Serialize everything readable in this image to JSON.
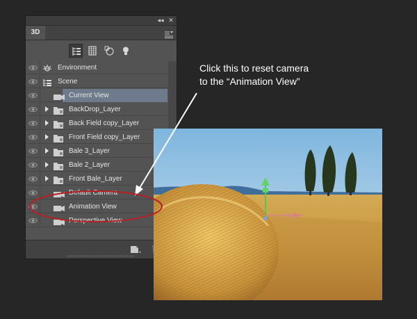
{
  "panel": {
    "tab_label": "3D",
    "collapse_glyph": "◂◂",
    "close_glyph": "✕",
    "tools": [
      {
        "name": "scene-filter-icon",
        "active": true
      },
      {
        "name": "mesh-filter-icon",
        "active": false
      },
      {
        "name": "materials-filter-icon",
        "active": false
      },
      {
        "name": "lights-filter-icon",
        "active": false
      }
    ],
    "rows": [
      {
        "label": "Environment",
        "indent": 0,
        "icon": "environment-icon",
        "arrow": false,
        "eye": true,
        "selected": false
      },
      {
        "label": "Scene",
        "indent": 0,
        "icon": "scene-icon",
        "arrow": false,
        "eye": true,
        "selected": false
      },
      {
        "label": "Current View",
        "indent": 2,
        "icon": "camera-icon",
        "arrow": false,
        "eye": true,
        "selected": true
      },
      {
        "label": "BackDrop_Layer",
        "indent": 1,
        "icon": "mesh-folder-icon",
        "arrow": true,
        "eye": true,
        "selected": false
      },
      {
        "label": "Back Field copy_Layer",
        "indent": 1,
        "icon": "mesh-folder-icon",
        "arrow": true,
        "eye": true,
        "selected": false
      },
      {
        "label": "Front Field copy_Layer",
        "indent": 1,
        "icon": "mesh-folder-icon",
        "arrow": true,
        "eye": true,
        "selected": false
      },
      {
        "label": "Bale 3_Layer",
        "indent": 1,
        "icon": "mesh-folder-icon",
        "arrow": true,
        "eye": true,
        "selected": false
      },
      {
        "label": "Bale 2_Layer",
        "indent": 1,
        "icon": "mesh-folder-icon",
        "arrow": true,
        "eye": true,
        "selected": false
      },
      {
        "label": "Front Bale_Layer",
        "indent": 1,
        "icon": "mesh-folder-icon",
        "arrow": true,
        "eye": true,
        "selected": false
      },
      {
        "label": "Default Camera",
        "indent": 2,
        "icon": "camera-icon",
        "arrow": false,
        "eye": true,
        "selected": false
      },
      {
        "label": "Animation View",
        "indent": 2,
        "icon": "camera-icon",
        "arrow": false,
        "eye": true,
        "selected": false
      },
      {
        "label": "Perspective View",
        "indent": 2,
        "icon": "camera-icon",
        "arrow": false,
        "eye": true,
        "selected": false
      }
    ]
  },
  "annotation": {
    "line1": "Click this to reset camera",
    "line2": "to the “Animation View”",
    "accent_color": "#b52025"
  }
}
